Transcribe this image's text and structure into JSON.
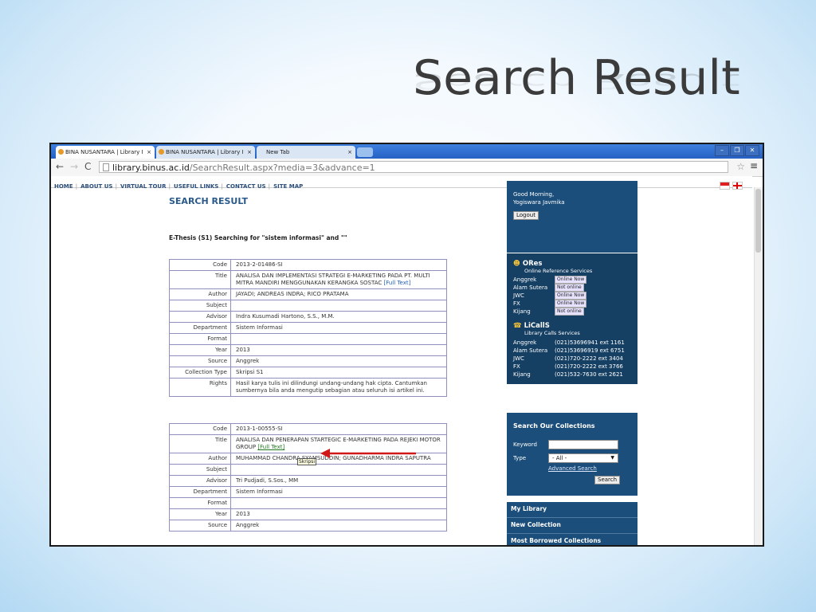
{
  "slide": {
    "title": "Search Result"
  },
  "browser": {
    "tabs": [
      {
        "label": "BINA NUSANTARA | Library I"
      },
      {
        "label": "BINA NUSANTARA | Library I"
      },
      {
        "label": "New Tab"
      }
    ],
    "close_glyph": "×",
    "url_host": "library.binus.ac.id",
    "url_path": "/SearchResult.aspx?media=3&advance=1"
  },
  "site_nav": [
    "HOME",
    "ABOUT US",
    "VIRTUAL TOUR",
    "USEFUL LINKS",
    "CONTACT US",
    "SITE MAP"
  ],
  "main": {
    "heading": "SEARCH RESULT",
    "query_line": "E-Thesis (S1) Searching for \"sistem informasi\" and \"\"",
    "labels": {
      "code": "Code",
      "title": "Title",
      "author": "Author",
      "subject": "Subject",
      "advisor": "Advisor",
      "department": "Department",
      "format": "Format",
      "year": "Year",
      "source": "Source",
      "collection_type": "Collection Type",
      "rights": "Rights"
    },
    "full_text_label": "[Full Text]",
    "record1": {
      "code": "2013-2-01486-SI",
      "title": "ANALISA DAN IMPLEMENTASI STRATEGI E-MARKETING PADA PT. MULTI MITRA MANDIRI MENGGUNAKAN KERANGKA SOSTAC",
      "author": "JAYADI; ANDREAS INDRA; RICO PRATAMA",
      "subject": "",
      "advisor": "Indra Kusumadi Hartono, S.S., M.M.",
      "department": "Sistem Informasi",
      "format": "",
      "year": "2013",
      "source": "Anggrek",
      "collection_type": "Skripsi S1",
      "rights": "Hasil karya tulis ini dilindungi undang-undang hak cipta. Cantumkan sumbernya bila anda mengutip sebagian atau seluruh isi artikel ini."
    },
    "record2": {
      "code": "2013-1-00555-SI",
      "title": "ANALISA DAN PENERAPAN STARTEGIC E-MARKETING PADA REJEKI MOTOR GROUP",
      "author": "MUHAMMAD CHANDRA SYAMSUDDIN; GUNADHARMA INDRA SAPUTRA",
      "subject": "",
      "advisor": "Tri Pudjadi, S.Sos., MM",
      "department": "Sistem Informasi",
      "format": "",
      "year": "2013",
      "source": "Anggrek"
    },
    "tooltip": "Skripsi"
  },
  "sidebar": {
    "greeting": "Good Morning,",
    "user": "Yogiswara Javmika",
    "logout": "Logout",
    "ores_title": "ORes",
    "ores_sub": "Online Reference Services",
    "ores": [
      {
        "campus": "Anggrek",
        "status": "Online Now"
      },
      {
        "campus": "Alam Sutera",
        "status": "Not online"
      },
      {
        "campus": "JWC",
        "status": "Online Now"
      },
      {
        "campus": "FX",
        "status": "Online Now"
      },
      {
        "campus": "Kijang",
        "status": "Not online"
      }
    ],
    "licalls_title": "LiCallS",
    "licalls_sub": "Library Calls Services",
    "licalls": [
      {
        "campus": "Anggrek",
        "phone": "(021)53696941 ext 1161"
      },
      {
        "campus": "Alam Sutera",
        "phone": "(021)53696919 ext 6751"
      },
      {
        "campus": "JWC",
        "phone": "(021)720-2222 ext 3404"
      },
      {
        "campus": "FX",
        "phone": "(021)720-2222 ext 3766"
      },
      {
        "campus": "Kijang",
        "phone": "(021)532-7630 ext 2621"
      }
    ],
    "search_title": "Search Our Collections",
    "keyword_label": "Keyword",
    "type_label": "Type",
    "type_value": "- All -",
    "advanced_search": "Advanced Search",
    "search_button": "Search",
    "links": [
      "My Library",
      "New Collection",
      "Most Borrowed Collections"
    ]
  },
  "colors": {
    "panel": "#1b4e7a",
    "heading": "#2a5a8c",
    "arrow": "#d01818"
  }
}
